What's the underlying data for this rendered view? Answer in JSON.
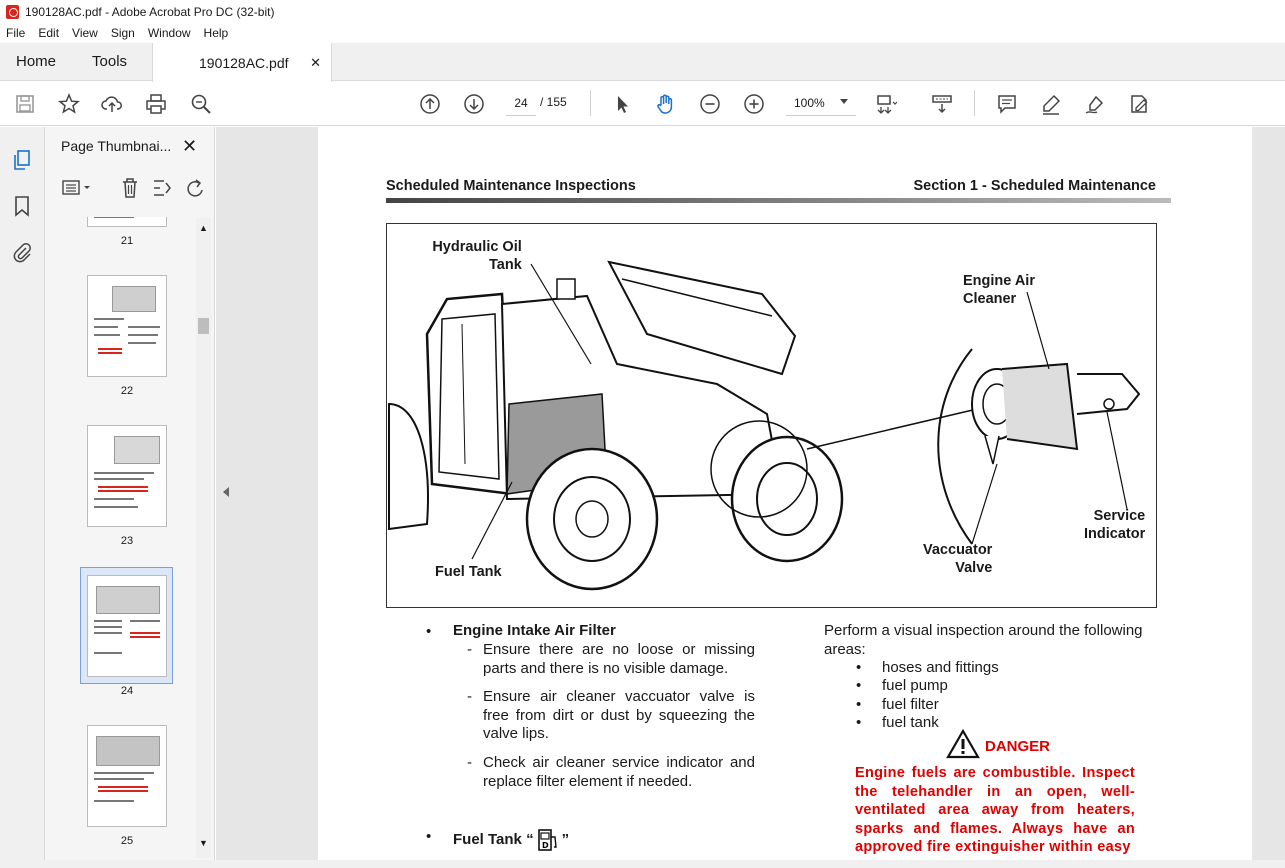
{
  "window": {
    "title": "190128AC.pdf - Adobe Acrobat Pro DC (32-bit)"
  },
  "menu": [
    "File",
    "Edit",
    "View",
    "Sign",
    "Window",
    "Help"
  ],
  "tabs": {
    "home": "Home",
    "tools": "Tools",
    "document": "190128AC.pdf"
  },
  "toolbar": {
    "page_current": "24",
    "page_total": "/ 155",
    "zoom": "100%"
  },
  "sidebar": {
    "title": "Page Thumbnai...",
    "thumbnails": [
      {
        "label": "21"
      },
      {
        "label": "22"
      },
      {
        "label": "23"
      },
      {
        "label": "24",
        "selected": true
      },
      {
        "label": "25"
      }
    ]
  },
  "document": {
    "header_left": "Scheduled Maintenance Inspections",
    "header_right": "Section 1 - Scheduled Maintenance",
    "figure_labels": {
      "hydraulic_1": "Hydraulic Oil",
      "hydraulic_2": "Tank",
      "air_cleaner_1": "Engine Air",
      "air_cleaner_2": "Cleaner",
      "fuel_tank": "Fuel Tank",
      "vaccuator_1": "Vaccuator",
      "vaccuator_2": "Valve",
      "service_1": "Service",
      "service_2": "Indicator"
    },
    "left_column": {
      "item1_title": "Engine Intake Air Filter",
      "item1_points": [
        "Ensure there are no loose or missing parts and there is no visible damage.",
        "Ensure air cleaner vaccuator valve is free from dirt or dust by squeezing the valve lips.",
        "Check air cleaner service indicator and replace filter element if needed."
      ],
      "item2_title_prefix": "Fuel Tank “",
      "item2_title_suffix": "”"
    },
    "right_column": {
      "intro": "Perform a visual inspection around the following areas:",
      "areas": [
        "hoses and fittings",
        "fuel pump",
        "fuel filter",
        "fuel tank"
      ],
      "danger_title": "DANGER",
      "danger_text": "Engine fuels are combustible. Inspect the telehandler in an open, well-ventilated area away from heaters, sparks and flames. Always have an approved fire extinguisher within easy"
    }
  },
  "colors": {
    "danger": "#e00000",
    "pdf_red": "#d9261c"
  }
}
